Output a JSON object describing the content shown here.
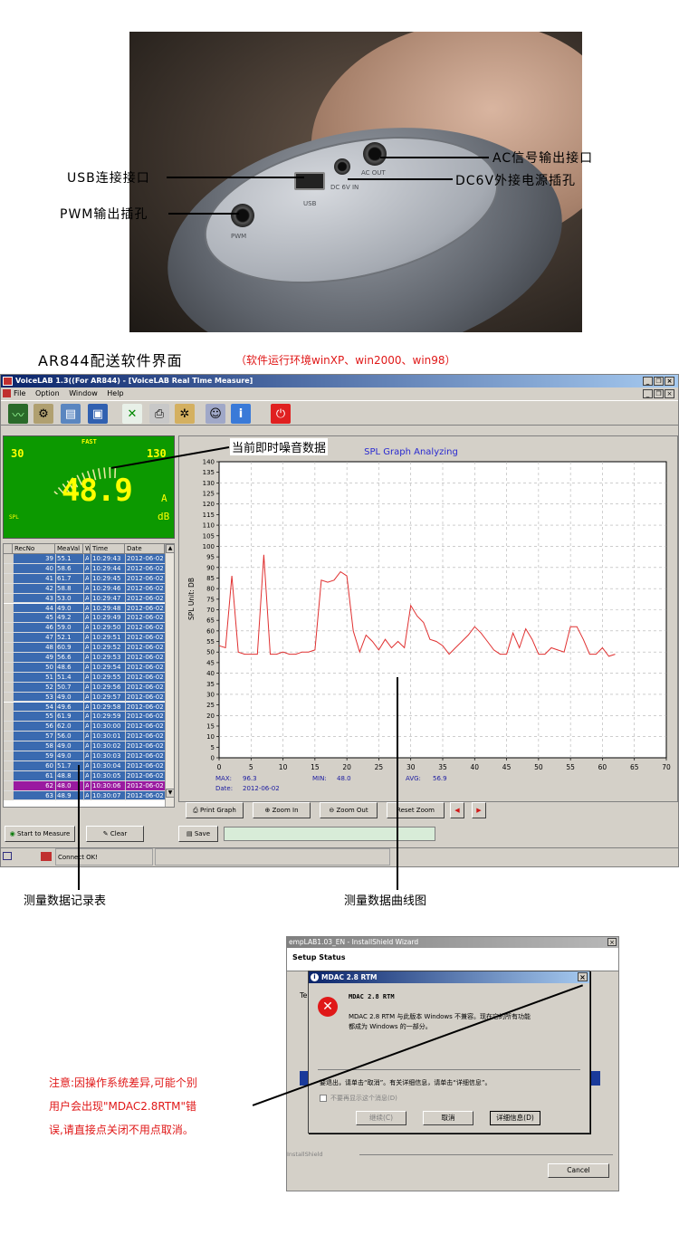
{
  "photo_callouts": {
    "ac_output": "AC信号输出接口",
    "usb_port": "USB连接接口",
    "dc_power": "DC6V外接电源插孔",
    "pwm_output": "PWM输出插孔",
    "panel_usb": "USB",
    "panel_dc": "DC 6V IN",
    "panel_ac": "AC OUT",
    "panel_pwm": "PWM"
  },
  "section": {
    "heading": "AR844配送软件界面",
    "note": "（软件运行环境winXP、win2000、win98）"
  },
  "app": {
    "title": "VoiceLAB 1.3((For AR844) - [VoiceLAB Real Time Measure]",
    "menu": [
      "File",
      "Option",
      "Window",
      "Help"
    ],
    "meter": {
      "mode": "FAST",
      "range_low": "30",
      "range_high": "130",
      "reading": "48.9",
      "weighting": "A",
      "unit": "dB",
      "spl_label": "SPL"
    },
    "table_headers": [
      "RecNo",
      "MeaVal",
      "W",
      "Time",
      "Date"
    ],
    "table_rows": [
      {
        "no": "39",
        "val": "55.1",
        "w": "A",
        "time": "10:29:43",
        "date": "2012-06-02"
      },
      {
        "no": "40",
        "val": "58.6",
        "w": "A",
        "time": "10:29:44",
        "date": "2012-06-02"
      },
      {
        "no": "41",
        "val": "61.7",
        "w": "A",
        "time": "10:29:45",
        "date": "2012-06-02"
      },
      {
        "no": "42",
        "val": "58.8",
        "w": "A",
        "time": "10:29:46",
        "date": "2012-06-02"
      },
      {
        "no": "43",
        "val": "53.0",
        "w": "A",
        "time": "10:29:47",
        "date": "2012-06-02"
      },
      {
        "no": "44",
        "val": "49.0",
        "w": "A",
        "time": "10:29:48",
        "date": "2012-06-02"
      },
      {
        "no": "45",
        "val": "49.2",
        "w": "A",
        "time": "10:29:49",
        "date": "2012-06-02"
      },
      {
        "no": "46",
        "val": "59.0",
        "w": "A",
        "time": "10:29:50",
        "date": "2012-06-02"
      },
      {
        "no": "47",
        "val": "52.1",
        "w": "A",
        "time": "10:29:51",
        "date": "2012-06-02"
      },
      {
        "no": "48",
        "val": "60.9",
        "w": "A",
        "time": "10:29:52",
        "date": "2012-06-02"
      },
      {
        "no": "49",
        "val": "56.6",
        "w": "A",
        "time": "10:29:53",
        "date": "2012-06-02"
      },
      {
        "no": "50",
        "val": "48.6",
        "w": "A",
        "time": "10:29:54",
        "date": "2012-06-02"
      },
      {
        "no": "51",
        "val": "51.4",
        "w": "A",
        "time": "10:29:55",
        "date": "2012-06-02"
      },
      {
        "no": "52",
        "val": "50.7",
        "w": "A",
        "time": "10:29:56",
        "date": "2012-06-02"
      },
      {
        "no": "53",
        "val": "49.0",
        "w": "A",
        "time": "10:29:57",
        "date": "2012-06-02"
      },
      {
        "no": "54",
        "val": "49.6",
        "w": "A",
        "time": "10:29:58",
        "date": "2012-06-02"
      },
      {
        "no": "55",
        "val": "61.9",
        "w": "A",
        "time": "10:29:59",
        "date": "2012-06-02"
      },
      {
        "no": "56",
        "val": "62.0",
        "w": "A",
        "time": "10:30:00",
        "date": "2012-06-02"
      },
      {
        "no": "57",
        "val": "56.0",
        "w": "A",
        "time": "10:30:01",
        "date": "2012-06-02"
      },
      {
        "no": "58",
        "val": "49.0",
        "w": "A",
        "time": "10:30:02",
        "date": "2012-06-02"
      },
      {
        "no": "59",
        "val": "49.0",
        "w": "A",
        "time": "10:30:03",
        "date": "2012-06-02"
      },
      {
        "no": "60",
        "val": "51.7",
        "w": "A",
        "time": "10:30:04",
        "date": "2012-06-02"
      },
      {
        "no": "61",
        "val": "48.8",
        "w": "A",
        "time": "10:30:05",
        "date": "2012-06-02"
      },
      {
        "no": "62",
        "val": "48.0",
        "w": "A",
        "time": "10:30:06",
        "date": "2012-06-02"
      },
      {
        "no": "63",
        "val": "48.9",
        "w": "A",
        "time": "10:30:07",
        "date": "2012-06-02"
      }
    ],
    "selected_row": "62",
    "graph_callout": "当前即时噪音数据",
    "stats": {
      "max_label": "MAX:",
      "max_value": "96.3",
      "min_label": "MIN:",
      "min_value": "48.0",
      "avg_label": "AVG:",
      "avg_value": "56.9",
      "date_label": "Date:",
      "date_value": "2012-06-02"
    },
    "buttons": {
      "print_graph": "Print Graph",
      "zoom_in": "Zoom In",
      "zoom_out": "Zoom Out",
      "reset_zoom": "Reset Zoom",
      "start": "Start to Measure",
      "clear": "Clear",
      "save": "Save"
    },
    "status_text": "Connect OK!",
    "caption_table": "测量数据记录表",
    "caption_graph": "测量数据曲线图"
  },
  "chart_data": {
    "type": "line",
    "title": "SPL Graph Analyzing",
    "xlabel": "",
    "ylabel": "SPL Unit: DB",
    "xlim": [
      0,
      70
    ],
    "ylim": [
      0,
      140
    ],
    "xticks": [
      0,
      5,
      10,
      15,
      20,
      25,
      30,
      35,
      40,
      45,
      50,
      55,
      60,
      65,
      70
    ],
    "yticks": [
      0,
      5,
      10,
      15,
      20,
      25,
      30,
      35,
      40,
      45,
      50,
      55,
      60,
      65,
      70,
      75,
      80,
      85,
      90,
      95,
      100,
      105,
      110,
      115,
      120,
      125,
      130,
      135,
      140
    ],
    "grid": true,
    "series_color": "#e03030",
    "series": [
      {
        "x": [
          0,
          1,
          2,
          3,
          4,
          5,
          6,
          7,
          8,
          9,
          10,
          11,
          12,
          13,
          14,
          15,
          16,
          17,
          18,
          19,
          20,
          21,
          22,
          23,
          24,
          25,
          26,
          27,
          28,
          29,
          30,
          31,
          32,
          33,
          34,
          35,
          36,
          37,
          38,
          39,
          40,
          41,
          42,
          43,
          44,
          45,
          46,
          47,
          48,
          49,
          50,
          51,
          52,
          53,
          54,
          55,
          56,
          57,
          58,
          59,
          60,
          61,
          62
        ],
        "y": [
          53,
          52,
          86,
          50,
          49,
          49,
          49,
          96,
          49,
          49,
          50,
          49,
          49,
          50,
          50,
          51,
          84,
          83,
          84,
          88,
          86,
          60,
          50,
          58,
          55,
          51,
          56,
          52,
          55,
          52,
          72,
          67,
          64,
          56,
          55,
          53,
          49,
          52,
          55,
          58,
          62,
          59,
          55,
          51,
          49,
          49,
          59,
          52,
          61,
          56,
          49,
          49,
          52,
          51,
          50,
          62,
          62,
          56,
          49,
          49,
          52,
          48,
          49
        ]
      }
    ]
  },
  "dialogs": {
    "install_title": "empLAB1.03_EN - InstallShield Wizard",
    "setup_status": "Setup Status",
    "install_te": "Te",
    "installshield": "InstallShield",
    "cancel": "Cancel",
    "mdac_title": "MDAC 2.8 RTM",
    "mdac_heading": "MDAC 2.8 RTM",
    "mdac_message_1": "MDAC 2.8 RTM 与此版本 Windows 不兼容。现在它的所有功能",
    "mdac_message_2": "都成为 Windows 的一部分。",
    "mdac_prompt": "要退出，请单击“取消”。有关详细信息，请单击“详细信息”。",
    "mdac_checkbox": "不要再显示这个消息(D)",
    "btn_continue": "继续(C)",
    "btn_cancel": "取消",
    "btn_details": "详细信息(D)"
  },
  "warning_note": {
    "line1": "注意:因操作系统差异,可能个别",
    "line2": "用户会出现\"MDAC2.8RTM\"错",
    "line3": "误,请直接点关闭不用点取消。"
  }
}
